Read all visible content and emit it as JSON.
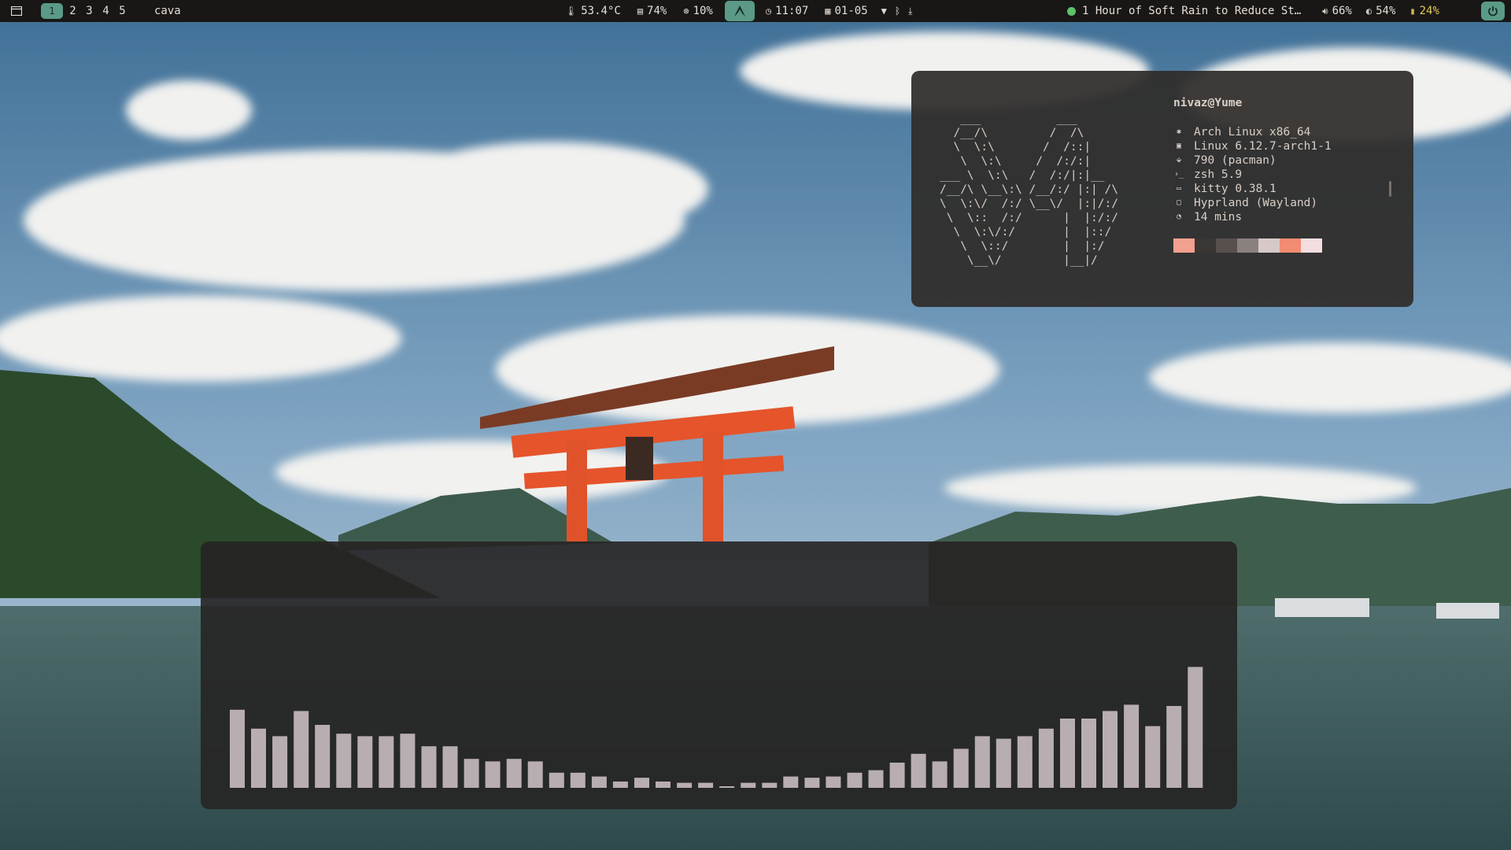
{
  "colors": {
    "accent": "#5a9a86",
    "bar_bg": "#181716",
    "text": "#e8ddd4",
    "cava_bar": "#b8aeb2",
    "media_dot": "#5dc36a",
    "battery": "#e6c65a"
  },
  "topbar": {
    "menu_icon": "sidebar-icon",
    "workspaces": [
      {
        "label": "1",
        "active": true
      },
      {
        "label": "2",
        "active": false
      },
      {
        "label": "3",
        "active": false
      },
      {
        "label": "4",
        "active": false
      },
      {
        "label": "5",
        "active": false
      }
    ],
    "window_title": "cava",
    "temperature": "53.4°C",
    "memory": "74%",
    "cpu": "10%",
    "clock": "11:07",
    "date": "01-05",
    "media_title": "1 Hour of Soft Rain to Reduce St…",
    "volume": "66%",
    "brightness": "54%",
    "battery": "24%"
  },
  "fastfetch": {
    "user": "nivaz@Yume",
    "info": [
      {
        "icon": "gear-icon",
        "text": "Arch Linux x86_64"
      },
      {
        "icon": "chip-icon",
        "text": "Linux 6.12.7-arch1-1"
      },
      {
        "icon": "package-icon",
        "text": "790 (pacman)"
      },
      {
        "icon": "terminal-icon",
        "text": "zsh 5.9"
      },
      {
        "icon": "window-icon",
        "text": "kitty 0.38.1"
      },
      {
        "icon": "monitor-icon",
        "text": "Hyprland (Wayland)"
      },
      {
        "icon": "clock-icon",
        "text": "14 mins"
      }
    ],
    "swatches": [
      "#f2a08f",
      "#3a3634",
      "#57504d",
      "#8a807f",
      "#d8c9c8",
      "#f28c73",
      "#f2dede"
    ]
  },
  "cava": {
    "levels": [
      0.62,
      0.47,
      0.41,
      0.61,
      0.5,
      0.43,
      0.41,
      0.41,
      0.43,
      0.33,
      0.33,
      0.23,
      0.21,
      0.23,
      0.21,
      0.12,
      0.12,
      0.09,
      0.05,
      0.08,
      0.05,
      0.04,
      0.04,
      0.01,
      0.04,
      0.04,
      0.09,
      0.08,
      0.09,
      0.12,
      0.14,
      0.2,
      0.27,
      0.21,
      0.31,
      0.41,
      0.39,
      0.41,
      0.47,
      0.55,
      0.55,
      0.61,
      0.66,
      0.49,
      0.65,
      0.96
    ]
  }
}
